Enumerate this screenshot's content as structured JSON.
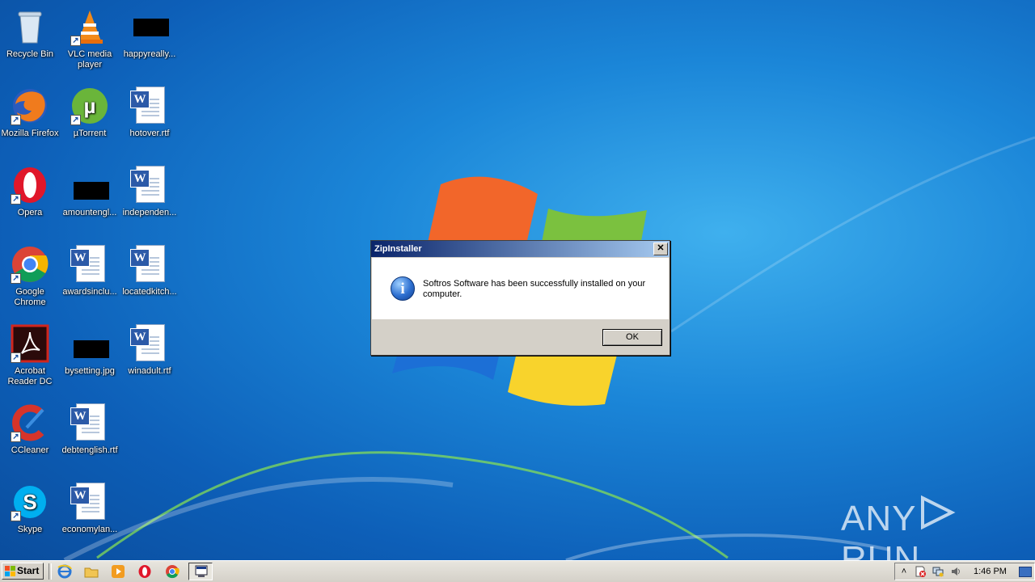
{
  "desktop": {
    "icons": [
      {
        "label": "Recycle Bin",
        "icon": "recycle-bin-icon"
      },
      {
        "label": "VLC media player",
        "icon": "vlc-icon"
      },
      {
        "label": "happyreally...",
        "icon": "image-thumbnail-icon"
      },
      {
        "label": "Mozilla Firefox",
        "icon": "firefox-icon"
      },
      {
        "label": "µTorrent",
        "icon": "utorrent-icon"
      },
      {
        "label": "hotover.rtf",
        "icon": "word-document-icon"
      },
      {
        "label": "Opera",
        "icon": "opera-icon"
      },
      {
        "label": "amountengl...",
        "icon": "image-thumbnail-icon"
      },
      {
        "label": "independen...",
        "icon": "word-document-icon"
      },
      {
        "label": "Google Chrome",
        "icon": "chrome-icon"
      },
      {
        "label": "awardsinclu...",
        "icon": "word-document-icon"
      },
      {
        "label": "locatedkitch...",
        "icon": "word-document-icon"
      },
      {
        "label": "Acrobat Reader DC",
        "icon": "acrobat-icon"
      },
      {
        "label": "bysetting.jpg",
        "icon": "image-thumbnail-icon"
      },
      {
        "label": "winadult.rtf",
        "icon": "word-document-icon"
      },
      {
        "label": "CCleaner",
        "icon": "ccleaner-icon"
      },
      {
        "label": "debtenglish.rtf",
        "icon": "word-document-icon"
      },
      {
        "label": "Skype",
        "icon": "skype-icon"
      },
      {
        "label": "economylan...",
        "icon": "word-document-icon"
      }
    ]
  },
  "dialog": {
    "title": "ZipInstaller",
    "close_glyph": "✕",
    "message": "Softros Software has been successfully installed on your computer.",
    "ok_label": "OK"
  },
  "watermark": {
    "left": "ANY",
    "right": "RUN"
  },
  "taskbar": {
    "start_label": "Start",
    "quick_launch": [
      "internet-explorer-icon",
      "explorer-folder-icon",
      "media-player-icon",
      "opera-icon",
      "chrome-icon"
    ],
    "tray": {
      "chevron": "˄",
      "clock": "1:46 PM"
    }
  }
}
